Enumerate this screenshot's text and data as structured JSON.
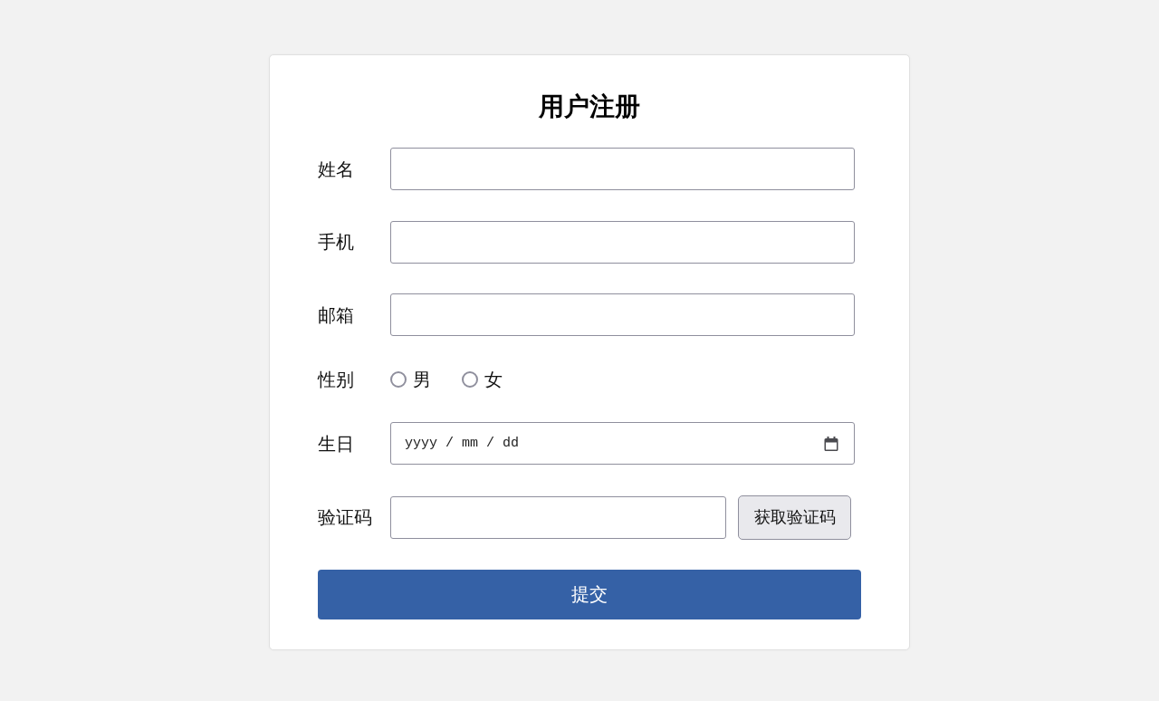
{
  "form": {
    "title": "用户注册",
    "fields": [
      {
        "kind": "text",
        "label": "姓名"
      },
      {
        "kind": "text",
        "label": "手机"
      },
      {
        "kind": "text",
        "label": "邮箱"
      },
      {
        "kind": "radio",
        "label": "性别",
        "options": [
          {
            "label": "男",
            "selected": false
          },
          {
            "label": "女",
            "selected": false
          }
        ]
      },
      {
        "kind": "date",
        "label": "生日",
        "placeholder": "yyyy / mm / dd"
      },
      {
        "kind": "captcha",
        "label": "验证码",
        "button": "获取验证码"
      }
    ],
    "submit_button": "提交"
  }
}
